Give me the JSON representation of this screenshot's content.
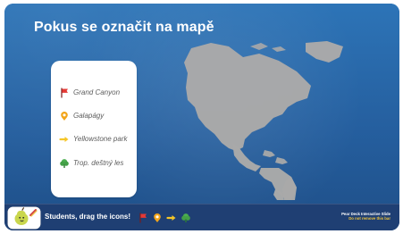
{
  "slide": {
    "title": "Pokus se označit na mapě",
    "legend": [
      {
        "label": "Grand Canyon",
        "icon": "red-flag-icon",
        "color": "#e53935"
      },
      {
        "label": "Galapágy",
        "icon": "map-pin-icon",
        "color": "#f2a51a"
      },
      {
        "label": "Yellowstone park",
        "icon": "yellow-arrow-icon",
        "color": "#f5c628"
      },
      {
        "label": "Trop. deštný les",
        "icon": "green-tree-icon",
        "color": "#4caf50"
      }
    ],
    "map": {
      "land_color": "#a9a9a9",
      "ocean_color": "#2b6fb0"
    }
  },
  "bottom_bar": {
    "text": "Students, drag the icons!",
    "right_line1": "Pear Deck Interactive Slide",
    "right_line2": "Do not remove this bar",
    "icons": [
      "red-flag-icon",
      "map-pin-icon",
      "yellow-arrow-icon",
      "green-tree-icon"
    ],
    "colors": {
      "bg": "#1f3f73",
      "accent": "#f3c637"
    }
  }
}
